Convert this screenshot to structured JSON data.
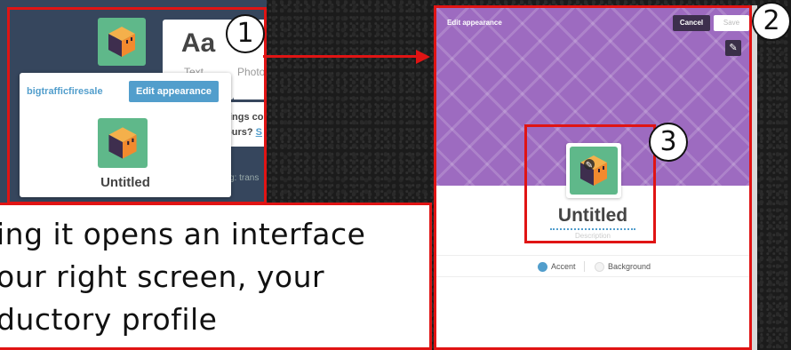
{
  "left_panel": {
    "post_types": [
      {
        "icon_text": "Aa",
        "label": "Text"
      },
      {
        "label": "Photo"
      }
    ],
    "dropdown": {
      "blog_name": "bigtrafficfiresale",
      "edit_button_label": "Edit appearance",
      "blog_title": "Untitled"
    },
    "background_fragments": {
      "line1": "ings co",
      "line2_prefix": "ours? ",
      "line2_link": "S",
      "line3": "g: trans"
    }
  },
  "markers": [
    "1",
    "2",
    "3"
  ],
  "caption": {
    "line1": "ing it opens an interface",
    "line2": "our right screen, your",
    "line3": "ductory profile"
  },
  "editor": {
    "title": "Edit appearance",
    "cancel_label": "Cancel",
    "save_label": "Save",
    "blog_title": "Untitled",
    "description_placeholder": "Description",
    "swatches": [
      {
        "label": "Accent",
        "color": "#529ecc"
      },
      {
        "label": "Background",
        "color": "#f3f3f3"
      }
    ],
    "header_color": "#9d6bc0"
  },
  "colors": {
    "highlight_red": "#e01414",
    "tumblr_navy": "#36465d",
    "accent_blue": "#529ecc"
  },
  "icons": [
    "cube-avatar-icon",
    "pencil-icon",
    "arrow-right-icon"
  ]
}
